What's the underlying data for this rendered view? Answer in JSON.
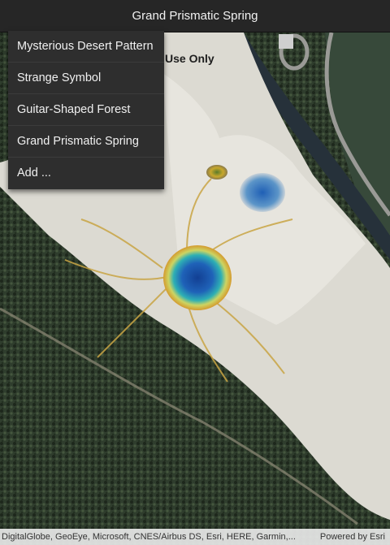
{
  "header": {
    "title": "Grand Prismatic Spring"
  },
  "menu": {
    "items": [
      {
        "label": "Mysterious Desert Pattern"
      },
      {
        "label": "Strange Symbol"
      },
      {
        "label": "Guitar-Shaped Forest"
      },
      {
        "label": "Grand Prismatic Spring"
      },
      {
        "label": "Add ..."
      }
    ]
  },
  "map": {
    "watermark": "Use Only",
    "attribution": "DigitalGlobe, GeoEye, Microsoft, CNES/Airbus DS, Esri, HERE, Garmin,...",
    "powered_by": "Powered by Esri"
  },
  "colors": {
    "toolbar": "#262626",
    "menu_bg": "#2e2e2e",
    "spring_blue": "#1e5fb0",
    "spring_teal": "#2fb2b0",
    "mineral_yellow": "#d7b64a"
  }
}
